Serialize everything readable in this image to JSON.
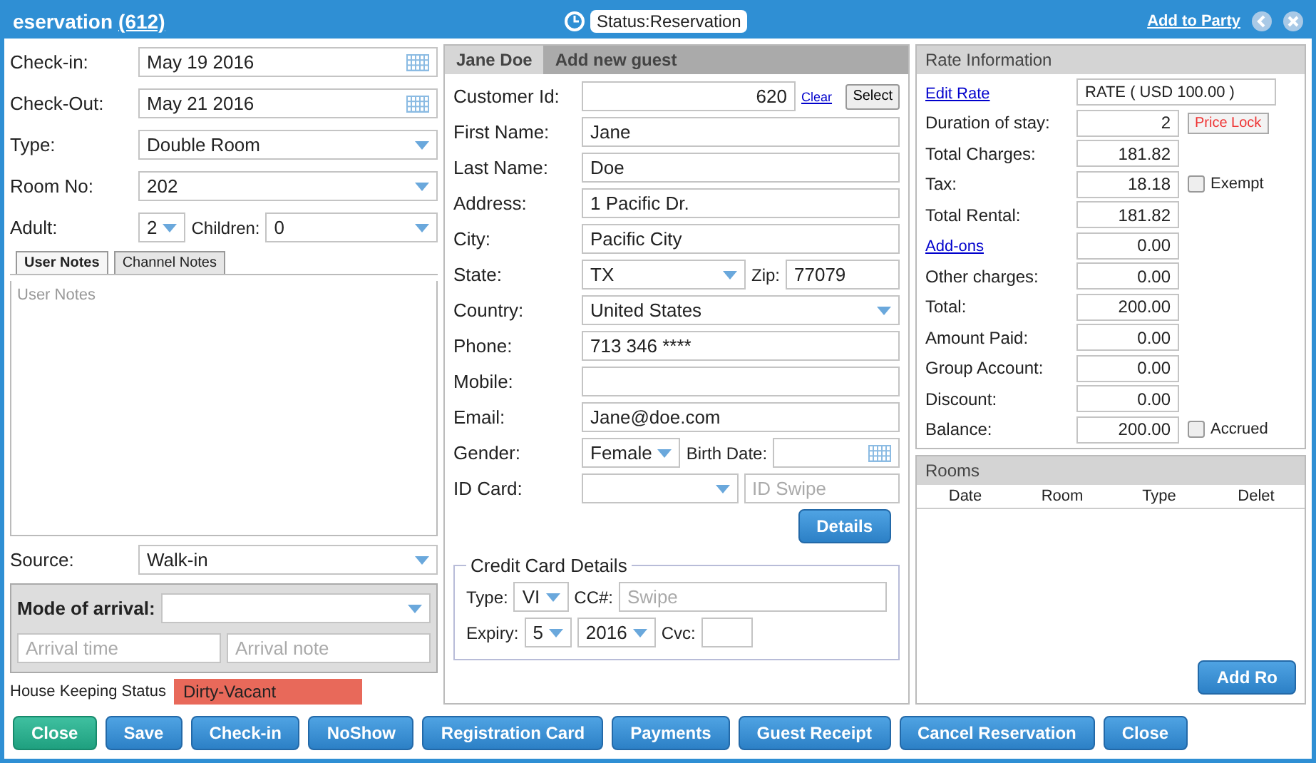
{
  "window": {
    "title": "eservation",
    "number": "(612)",
    "status": "Status:Reservation",
    "party_link": "Add to Party"
  },
  "reservation": {
    "fields": [
      {
        "kind": "date",
        "label": "Check-in:",
        "value": "May 19 2016"
      },
      {
        "kind": "date",
        "label": "Check-Out:",
        "value": "May 21 2016"
      },
      {
        "kind": "select",
        "label": "Type:",
        "value": "Double Room"
      },
      {
        "kind": "select",
        "label": "Room No:",
        "value": "202"
      }
    ],
    "adult": {
      "label": "Adult:",
      "value": "2"
    },
    "children": {
      "label": "Children:",
      "value": "0"
    },
    "notes_tabs": [
      {
        "label": "User Notes",
        "selected": true
      },
      {
        "label": "Channel Notes",
        "selected": false
      }
    ],
    "notes": {
      "placeholder": "User Notes"
    },
    "source": {
      "label": "Source:",
      "value": "Walk-in"
    },
    "arrival": {
      "label": "Mode of arrival:",
      "time_placeholder": "Arrival time",
      "note_placeholder": "Arrival note"
    },
    "housekeeping": {
      "label": "House Keeping Status",
      "value": "Dirty-Vacant",
      "color": "#e8695a"
    }
  },
  "guest": {
    "tabs": [
      {
        "label": "Jane Doe",
        "selected": true
      },
      {
        "label": "Add new guest",
        "selected": false
      }
    ],
    "customer_id": {
      "label": "Customer Id:",
      "value": "620",
      "clear": "Clear",
      "select": "Select"
    },
    "rows": [
      {
        "kind": "text",
        "label": "First Name:",
        "value": "Jane"
      },
      {
        "kind": "text",
        "label": "Last Name:",
        "value": "Doe"
      },
      {
        "kind": "text",
        "label": "Address:",
        "value": "1 Pacific Dr."
      },
      {
        "kind": "text",
        "label": "City:",
        "value": "Pacific City"
      },
      {
        "kind": "state",
        "label": "State:",
        "value": "TX",
        "zip_label": "Zip:",
        "zip_value": "77079"
      },
      {
        "kind": "select",
        "label": "Country:",
        "value": "United States"
      },
      {
        "kind": "text",
        "label": "Phone:",
        "value": "713 346 ****"
      },
      {
        "kind": "text",
        "label": "Mobile:"
      },
      {
        "kind": "text",
        "label": "Email:",
        "value": "Jane@doe.com"
      },
      {
        "kind": "gender",
        "label": "Gender:",
        "value": "Female",
        "birth_label": "Birth Date:"
      },
      {
        "kind": "idcard",
        "label": "ID Card:",
        "swipe_placeholder": "ID Swipe"
      }
    ],
    "details_button": "Details",
    "credit_card": {
      "title": "Credit Card Details",
      "type_label": "Type:",
      "type": "VI",
      "cc_label": "CC#:",
      "cc_placeholder": "Swipe",
      "expiry_label": "Expiry:",
      "month": "5",
      "year": "2016",
      "cvc_label": "Cvc:"
    }
  },
  "rate": {
    "title": "Rate Information",
    "edit_link": "Edit Rate",
    "rate_value": "RATE ( USD 100.00 )",
    "rows": [
      {
        "kind": "value",
        "label": "Duration of stay:",
        "value": "2",
        "button": "Price Lock"
      },
      {
        "kind": "value",
        "label": "Total Charges:",
        "value": "181.82"
      },
      {
        "kind": "value",
        "label": "Tax:",
        "value": "18.18",
        "checkbox": {
          "label": "Exempt",
          "checked": false
        }
      },
      {
        "kind": "value",
        "label": "Total Rental:",
        "value": "181.82"
      },
      {
        "kind": "link",
        "label": "Add-ons",
        "value": "0.00"
      },
      {
        "kind": "value",
        "label": "Other charges:",
        "value": "0.00"
      },
      {
        "kind": "value",
        "label": "Total:",
        "value": "200.00"
      },
      {
        "kind": "value",
        "label": "Amount Paid:",
        "value": "0.00"
      },
      {
        "kind": "value",
        "label": "Group Account:",
        "value": "0.00"
      },
      {
        "kind": "value",
        "label": "Discount:",
        "value": "0.00"
      },
      {
        "kind": "value",
        "label": "Balance:",
        "value": "200.00",
        "checkbox": {
          "label": "Accrued",
          "checked": false
        }
      }
    ]
  },
  "rooms": {
    "title": "Rooms",
    "columns": [
      "Date",
      "Room",
      "Type",
      "Delet"
    ],
    "add_button": "Add Ro"
  },
  "buttons": [
    {
      "kind": "success",
      "label": "Close"
    },
    {
      "kind": "primary",
      "label": "Save"
    },
    {
      "kind": "primary",
      "label": "Check-in"
    },
    {
      "kind": "primary",
      "label": "NoShow"
    },
    {
      "kind": "primary",
      "label": "Registration Card"
    },
    {
      "kind": "primary",
      "label": "Payments"
    },
    {
      "kind": "primary",
      "label": "Guest Receipt"
    },
    {
      "kind": "primary",
      "label": "Cancel Reservation"
    },
    {
      "kind": "primary",
      "label": "Close"
    }
  ]
}
